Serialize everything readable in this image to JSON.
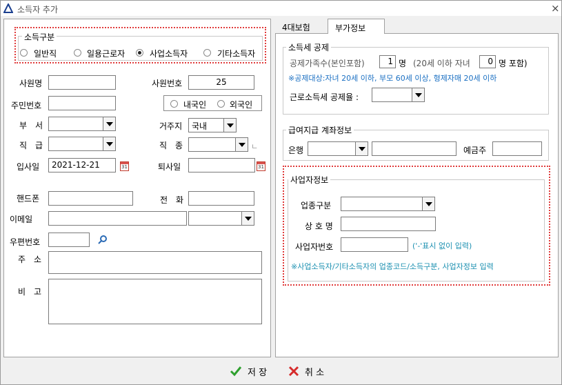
{
  "window": {
    "title": "소득자 추가",
    "close": "×"
  },
  "left": {
    "income_group": {
      "title": "소득구분",
      "options": [
        "일반직",
        "일용근로자",
        "사업소득자",
        "기타소득자"
      ],
      "selected": "사업소득자"
    },
    "emp_name_label": "사원명",
    "emp_name": "",
    "emp_no_label": "사원번호",
    "emp_no": "25",
    "rrn_label": "주민번호",
    "rrn": "",
    "nationality": {
      "options": [
        "내국인",
        "외국인"
      ],
      "selected": ""
    },
    "dept_label": "부　서",
    "dept": "",
    "residence_label": "거주지",
    "residence": "국내",
    "rank_label": "직　급",
    "rank": "",
    "jobtype_label": "직　종",
    "jobtype": "",
    "jobtype_extra": "ㄴ",
    "join_label": "입사일",
    "join_date": "2021-12-21",
    "leave_label": "퇴사일",
    "leave_date": "",
    "cal_day": "31",
    "mobile_label": "핸드폰",
    "mobile": "",
    "phone_label": "전　화",
    "phone": "",
    "email_label": "이메일",
    "email": "",
    "email_domain": "",
    "zip_label": "우편번호",
    "zip": "",
    "address_label": "주　소",
    "address": "",
    "memo_label": "비　고",
    "memo": ""
  },
  "tabs": [
    {
      "label": "4대보험"
    },
    {
      "label": "부가정보",
      "active": true
    }
  ],
  "right": {
    "tax_group": {
      "title": "소득세 공제",
      "dependents_label": "공제가족수(본인포함)",
      "dependents": "1",
      "unit1": "명",
      "under20_label": "(20세 이하 자녀",
      "under20": "0",
      "unit2": "명 포함)",
      "note": "※공제대상:자녀 20세 이하, 부모 60세 이상, 형제자매 20세 이하",
      "rate_label": "근로소득세 공제율 :",
      "rate": ""
    },
    "account_group": {
      "title": "급여지급 계좌정보",
      "bank_label": "은행",
      "bank": "",
      "account": "",
      "holder_label": "예금주",
      "holder": ""
    },
    "biz_group": {
      "title": "사업자정보",
      "type_label": "업종구분",
      "type": "",
      "name_label": "상 호 명",
      "name": "",
      "bizno_label": "사업자번호",
      "bizno": "",
      "bizno_hint": "('-'표시 없이 입력)",
      "note": "※사업소득자/기타소득자의 업종코드/소득구분, 사업자정보 입력"
    }
  },
  "footer": {
    "save": "저 장",
    "cancel": "취 소"
  },
  "colors": {
    "highlight": "#e03a3a",
    "note": "#1a6fc2",
    "save": "#2ea02e",
    "cancel": "#d62b2b"
  }
}
